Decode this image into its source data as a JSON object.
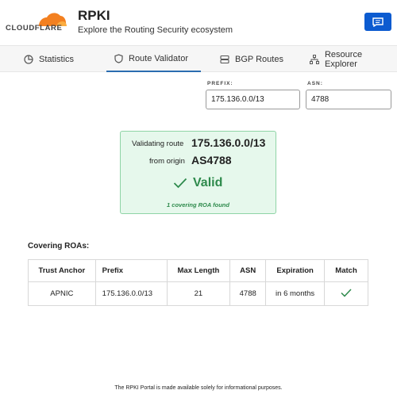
{
  "brand": {
    "logo_text": "CLOUDFLARE",
    "app_title": "RPKI",
    "app_subtitle": "Explore the Routing Security ecosystem",
    "accent_color": "#0c5bd0",
    "logo_color": "#f38020"
  },
  "tabs": [
    {
      "label": "Statistics",
      "icon": "pie-chart-icon",
      "active": false
    },
    {
      "label": "Route Validator",
      "icon": "shield-icon",
      "active": true
    },
    {
      "label": "BGP Routes",
      "icon": "server-icon",
      "active": false
    },
    {
      "label": "Resource Explorer",
      "icon": "network-icon",
      "active": false
    }
  ],
  "form": {
    "prefix_label": "PREFIX:",
    "prefix_value": "175.136.0.0/13",
    "asn_label": "ASN:",
    "asn_value": "4788"
  },
  "result": {
    "validating_label": "Validating route",
    "route": "175.136.0.0/13",
    "origin_label": "from origin",
    "origin": "AS4788",
    "status": "Valid",
    "status_color": "#2e8a4c",
    "roa_summary": "1 covering ROA found"
  },
  "covering": {
    "title": "Covering ROAs:",
    "columns": [
      "Trust Anchor",
      "Prefix",
      "Max Length",
      "ASN",
      "Expiration",
      "Match"
    ],
    "rows": [
      {
        "trust_anchor": "APNIC",
        "prefix": "175.136.0.0/13",
        "max_length": "21",
        "asn": "4788",
        "expiration": "in 6 months",
        "match": "check-icon"
      }
    ]
  },
  "footer": {
    "text": "The RPKI Portal is made available solely for informational purposes."
  }
}
